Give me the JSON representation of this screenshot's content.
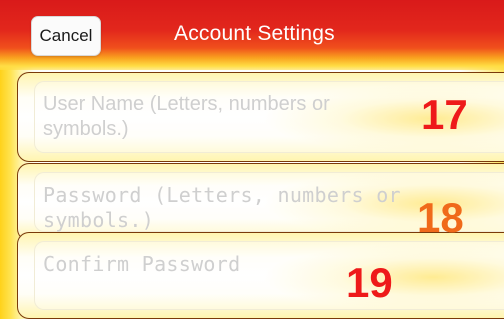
{
  "header": {
    "cancel_label": "Cancel",
    "title": "Account Settings",
    "background_color": "#e2271c"
  },
  "fields": [
    {
      "placeholder": "User Name (Letters, numbers or symbols.)",
      "value": "",
      "annotation": "17",
      "annotation_color": "#ee1a1a"
    },
    {
      "placeholder": "Password (Letters, numbers or symbols.)",
      "value": "",
      "annotation": "18",
      "annotation_color": "#f06a1a"
    },
    {
      "placeholder": "Confirm Password",
      "value": "",
      "annotation": "19",
      "annotation_color": "#ee1a1a"
    }
  ],
  "colors": {
    "highlight": "#ffdd44",
    "placeholder_text": "#cfcfcf",
    "row_border": "#7a3a0a"
  }
}
